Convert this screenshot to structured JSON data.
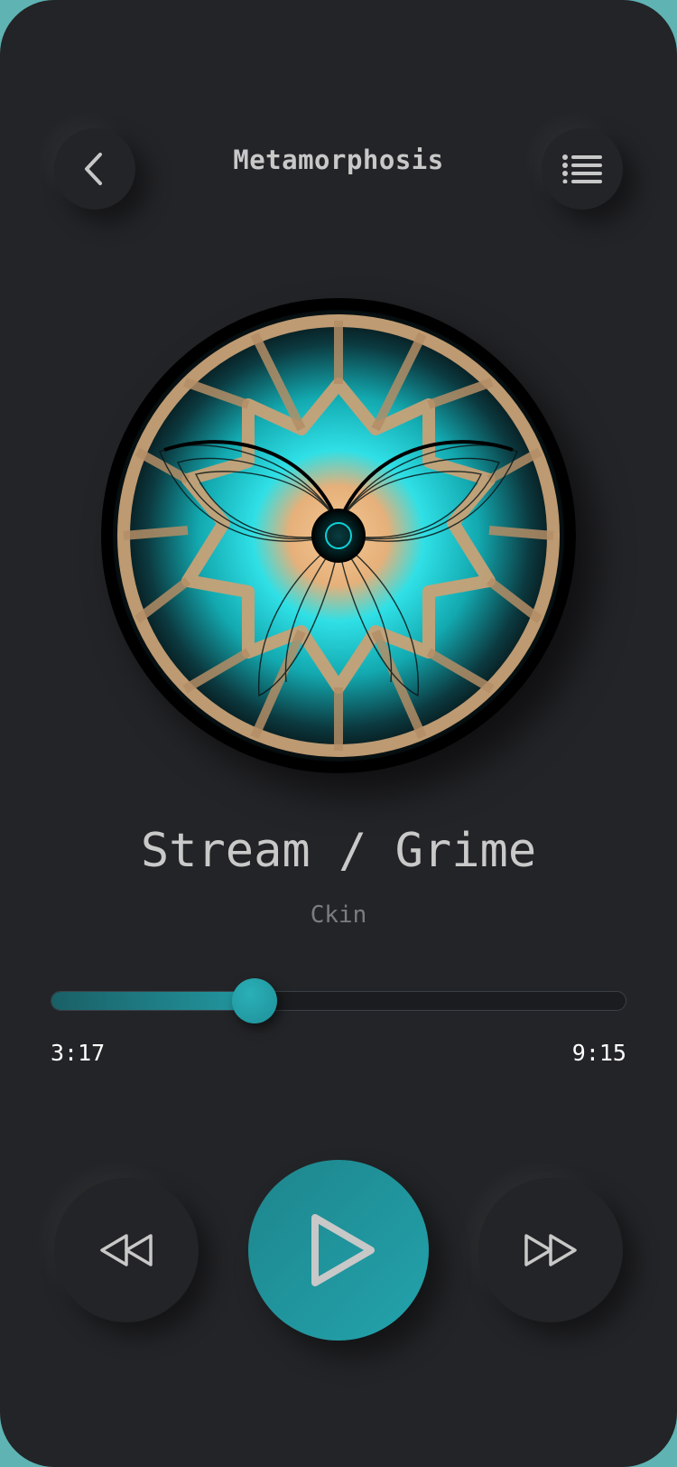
{
  "header": {
    "title": "Metamorphosis",
    "back_icon": "chevron-left-icon",
    "menu_icon": "list-menu-icon"
  },
  "album": {
    "art_icon": "butterfly-mandala-artwork"
  },
  "track": {
    "title": "Stream / Grime",
    "artist": "Ckin"
  },
  "progress": {
    "elapsed": "3:17",
    "duration": "9:15",
    "fraction": 0.355
  },
  "controls": {
    "rewind_icon": "rewind-icon",
    "play_icon": "play-icon",
    "forward_icon": "fast-forward-icon"
  },
  "colors": {
    "background": "#232427",
    "accent": "#239aa2",
    "frame_outer": "#5fb3b3"
  }
}
